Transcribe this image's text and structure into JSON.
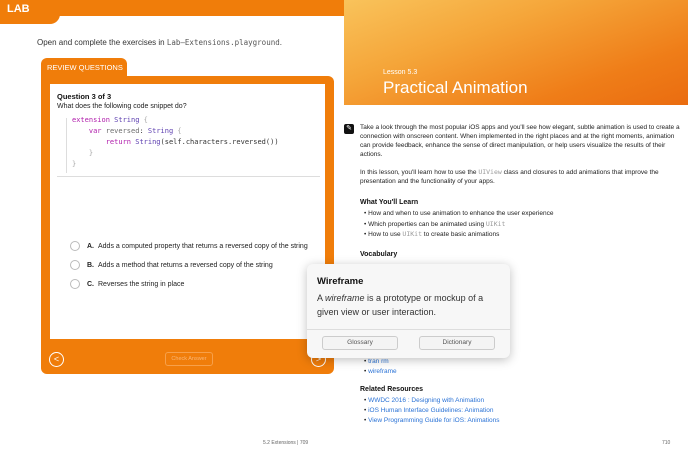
{
  "left": {
    "lab_label": "LAB",
    "intro_prefix": "Open and complete the exercises in ",
    "intro_file": "Lab–Extensions.playground",
    "intro_suffix": ".",
    "review_tab": "REVIEW QUESTIONS",
    "question_number": "Question 3 of 3",
    "question_text": "What does the following code snippet do?",
    "code": {
      "l1_kw": "extension",
      "l1_ty": "String",
      "l1_br": " {",
      "l2_kw": "var",
      "l2_id": " reversed",
      "l2_colon": ": ",
      "l2_ty": "String",
      "l2_br": " {",
      "l3_kw": "return",
      "l3_ty": " String",
      "l3_rest": "(self.characters.reversed())",
      "l4": "}",
      "l5": "}"
    },
    "answers": [
      {
        "letter": "A.",
        "text": "Adds a computed property that returns a reversed copy of the string"
      },
      {
        "letter": "B.",
        "text": "Adds a method that returns a reversed copy of the string"
      },
      {
        "letter": "C.",
        "text": "Reverses the string in place"
      }
    ],
    "check_answer": "Check Answer",
    "prev_icon": "<",
    "next_icon": ">",
    "footer": "5.2 Extensions  |  709"
  },
  "right": {
    "lesson_number": "Lesson 5.3",
    "lesson_title": "Practical Animation",
    "pencil_icon": "✎",
    "intro_para": "Take a look through the most popular iOS apps and you'll see how elegant, subtle animation is used to create a connection with onscreen content. When implemented in the right places and at the right moments, animation can provide feedback, enhance the sense of direct manipulation, or help users visualize the results of their actions.",
    "lesson_para_1": "In this lesson, you'll learn how to use the ",
    "lesson_para_code": "UIView",
    "lesson_para_2": " class and closures to add animations that improve the presentation and the functionality of your apps.",
    "learn_heading": "What You'll Learn",
    "learn_items": [
      {
        "text": "How and when to use animation to enhance the user experience",
        "code": ""
      },
      {
        "text": "Which properties can be animated using ",
        "code": "UIKit"
      },
      {
        "text": "How to use ",
        "code": "UIKit",
        "after": " to create basic animations"
      }
    ],
    "vocab_heading": "Vocabulary",
    "vocab_items": [
      "transform",
      "wireframe"
    ],
    "vocab_partial": "tran   rm",
    "resources_heading": "Related Resources",
    "resources": [
      "WWDC 2016 : Designing with Animation",
      "iOS Human Interface Guidelines: Animation",
      "View Programming Guide for iOS: Animations"
    ],
    "footer": "710"
  },
  "popover": {
    "title": "Wireframe",
    "definition_prefix": "A ",
    "definition_term": "wireframe",
    "definition_suffix": " is a prototype or mockup of a given view or user interaction.",
    "glossary_button": "Glossary",
    "dictionary_button": "Dictionary"
  },
  "colors": {
    "accent": "#f07d0a",
    "link": "#2b73d6"
  }
}
